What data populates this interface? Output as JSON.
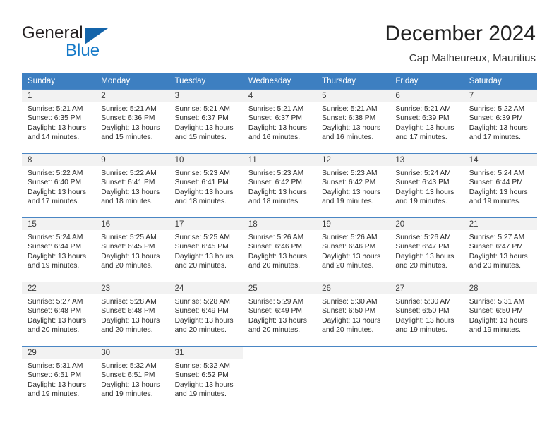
{
  "brand": {
    "name_part1": "General",
    "name_part2": "Blue",
    "triangle_color": "#1464aa",
    "blue_color": "#1479c8"
  },
  "header": {
    "title": "December 2024",
    "subtitle": "Cap Malheureux, Mauritius"
  },
  "theme": {
    "header_row_bg": "#3d7fc1",
    "header_row_text": "#ffffff",
    "daynum_band_bg": "#f2f2f2",
    "row_divider": "#4a86c4"
  },
  "weekday_headers": [
    "Sunday",
    "Monday",
    "Tuesday",
    "Wednesday",
    "Thursday",
    "Friday",
    "Saturday"
  ],
  "labels": {
    "sunrise_prefix": "Sunrise:",
    "sunset_prefix": "Sunset:",
    "daylight_prefix": "Daylight:"
  },
  "weeks": [
    [
      {
        "day": "1",
        "sunrise": "Sunrise: 5:21 AM",
        "sunset": "Sunset: 6:35 PM",
        "daylight_l1": "Daylight: 13 hours",
        "daylight_l2": "and 14 minutes."
      },
      {
        "day": "2",
        "sunrise": "Sunrise: 5:21 AM",
        "sunset": "Sunset: 6:36 PM",
        "daylight_l1": "Daylight: 13 hours",
        "daylight_l2": "and 15 minutes."
      },
      {
        "day": "3",
        "sunrise": "Sunrise: 5:21 AM",
        "sunset": "Sunset: 6:37 PM",
        "daylight_l1": "Daylight: 13 hours",
        "daylight_l2": "and 15 minutes."
      },
      {
        "day": "4",
        "sunrise": "Sunrise: 5:21 AM",
        "sunset": "Sunset: 6:37 PM",
        "daylight_l1": "Daylight: 13 hours",
        "daylight_l2": "and 16 minutes."
      },
      {
        "day": "5",
        "sunrise": "Sunrise: 5:21 AM",
        "sunset": "Sunset: 6:38 PM",
        "daylight_l1": "Daylight: 13 hours",
        "daylight_l2": "and 16 minutes."
      },
      {
        "day": "6",
        "sunrise": "Sunrise: 5:21 AM",
        "sunset": "Sunset: 6:39 PM",
        "daylight_l1": "Daylight: 13 hours",
        "daylight_l2": "and 17 minutes."
      },
      {
        "day": "7",
        "sunrise": "Sunrise: 5:22 AM",
        "sunset": "Sunset: 6:39 PM",
        "daylight_l1": "Daylight: 13 hours",
        "daylight_l2": "and 17 minutes."
      }
    ],
    [
      {
        "day": "8",
        "sunrise": "Sunrise: 5:22 AM",
        "sunset": "Sunset: 6:40 PM",
        "daylight_l1": "Daylight: 13 hours",
        "daylight_l2": "and 17 minutes."
      },
      {
        "day": "9",
        "sunrise": "Sunrise: 5:22 AM",
        "sunset": "Sunset: 6:41 PM",
        "daylight_l1": "Daylight: 13 hours",
        "daylight_l2": "and 18 minutes."
      },
      {
        "day": "10",
        "sunrise": "Sunrise: 5:23 AM",
        "sunset": "Sunset: 6:41 PM",
        "daylight_l1": "Daylight: 13 hours",
        "daylight_l2": "and 18 minutes."
      },
      {
        "day": "11",
        "sunrise": "Sunrise: 5:23 AM",
        "sunset": "Sunset: 6:42 PM",
        "daylight_l1": "Daylight: 13 hours",
        "daylight_l2": "and 18 minutes."
      },
      {
        "day": "12",
        "sunrise": "Sunrise: 5:23 AM",
        "sunset": "Sunset: 6:42 PM",
        "daylight_l1": "Daylight: 13 hours",
        "daylight_l2": "and 19 minutes."
      },
      {
        "day": "13",
        "sunrise": "Sunrise: 5:24 AM",
        "sunset": "Sunset: 6:43 PM",
        "daylight_l1": "Daylight: 13 hours",
        "daylight_l2": "and 19 minutes."
      },
      {
        "day": "14",
        "sunrise": "Sunrise: 5:24 AM",
        "sunset": "Sunset: 6:44 PM",
        "daylight_l1": "Daylight: 13 hours",
        "daylight_l2": "and 19 minutes."
      }
    ],
    [
      {
        "day": "15",
        "sunrise": "Sunrise: 5:24 AM",
        "sunset": "Sunset: 6:44 PM",
        "daylight_l1": "Daylight: 13 hours",
        "daylight_l2": "and 19 minutes."
      },
      {
        "day": "16",
        "sunrise": "Sunrise: 5:25 AM",
        "sunset": "Sunset: 6:45 PM",
        "daylight_l1": "Daylight: 13 hours",
        "daylight_l2": "and 20 minutes."
      },
      {
        "day": "17",
        "sunrise": "Sunrise: 5:25 AM",
        "sunset": "Sunset: 6:45 PM",
        "daylight_l1": "Daylight: 13 hours",
        "daylight_l2": "and 20 minutes."
      },
      {
        "day": "18",
        "sunrise": "Sunrise: 5:26 AM",
        "sunset": "Sunset: 6:46 PM",
        "daylight_l1": "Daylight: 13 hours",
        "daylight_l2": "and 20 minutes."
      },
      {
        "day": "19",
        "sunrise": "Sunrise: 5:26 AM",
        "sunset": "Sunset: 6:46 PM",
        "daylight_l1": "Daylight: 13 hours",
        "daylight_l2": "and 20 minutes."
      },
      {
        "day": "20",
        "sunrise": "Sunrise: 5:26 AM",
        "sunset": "Sunset: 6:47 PM",
        "daylight_l1": "Daylight: 13 hours",
        "daylight_l2": "and 20 minutes."
      },
      {
        "day": "21",
        "sunrise": "Sunrise: 5:27 AM",
        "sunset": "Sunset: 6:47 PM",
        "daylight_l1": "Daylight: 13 hours",
        "daylight_l2": "and 20 minutes."
      }
    ],
    [
      {
        "day": "22",
        "sunrise": "Sunrise: 5:27 AM",
        "sunset": "Sunset: 6:48 PM",
        "daylight_l1": "Daylight: 13 hours",
        "daylight_l2": "and 20 minutes."
      },
      {
        "day": "23",
        "sunrise": "Sunrise: 5:28 AM",
        "sunset": "Sunset: 6:48 PM",
        "daylight_l1": "Daylight: 13 hours",
        "daylight_l2": "and 20 minutes."
      },
      {
        "day": "24",
        "sunrise": "Sunrise: 5:28 AM",
        "sunset": "Sunset: 6:49 PM",
        "daylight_l1": "Daylight: 13 hours",
        "daylight_l2": "and 20 minutes."
      },
      {
        "day": "25",
        "sunrise": "Sunrise: 5:29 AM",
        "sunset": "Sunset: 6:49 PM",
        "daylight_l1": "Daylight: 13 hours",
        "daylight_l2": "and 20 minutes."
      },
      {
        "day": "26",
        "sunrise": "Sunrise: 5:30 AM",
        "sunset": "Sunset: 6:50 PM",
        "daylight_l1": "Daylight: 13 hours",
        "daylight_l2": "and 20 minutes."
      },
      {
        "day": "27",
        "sunrise": "Sunrise: 5:30 AM",
        "sunset": "Sunset: 6:50 PM",
        "daylight_l1": "Daylight: 13 hours",
        "daylight_l2": "and 19 minutes."
      },
      {
        "day": "28",
        "sunrise": "Sunrise: 5:31 AM",
        "sunset": "Sunset: 6:50 PM",
        "daylight_l1": "Daylight: 13 hours",
        "daylight_l2": "and 19 minutes."
      }
    ],
    [
      {
        "day": "29",
        "sunrise": "Sunrise: 5:31 AM",
        "sunset": "Sunset: 6:51 PM",
        "daylight_l1": "Daylight: 13 hours",
        "daylight_l2": "and 19 minutes."
      },
      {
        "day": "30",
        "sunrise": "Sunrise: 5:32 AM",
        "sunset": "Sunset: 6:51 PM",
        "daylight_l1": "Daylight: 13 hours",
        "daylight_l2": "and 19 minutes."
      },
      {
        "day": "31",
        "sunrise": "Sunrise: 5:32 AM",
        "sunset": "Sunset: 6:52 PM",
        "daylight_l1": "Daylight: 13 hours",
        "daylight_l2": "and 19 minutes."
      },
      {
        "day": "",
        "sunrise": "",
        "sunset": "",
        "daylight_l1": "",
        "daylight_l2": ""
      },
      {
        "day": "",
        "sunrise": "",
        "sunset": "",
        "daylight_l1": "",
        "daylight_l2": ""
      },
      {
        "day": "",
        "sunrise": "",
        "sunset": "",
        "daylight_l1": "",
        "daylight_l2": ""
      },
      {
        "day": "",
        "sunrise": "",
        "sunset": "",
        "daylight_l1": "",
        "daylight_l2": ""
      }
    ]
  ]
}
